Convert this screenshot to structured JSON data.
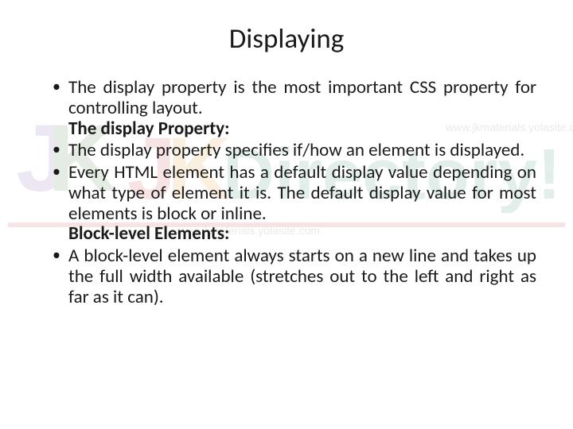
{
  "title": "Displaying",
  "bullets": [
    {
      "text": "The display property is the most important CSS property for controlling layout.",
      "subheading": "The display Property:"
    },
    {
      "text": "The display property specifies if/how an element is displayed.",
      "subheading": null
    },
    {
      "text": "Every HTML element has a default display value depending on what type of element it is. The default display value for most elements is block or inline.",
      "subheading": "Block-level Elements:"
    },
    {
      "text": "A block-level element always starts on a new line and takes up the full width available (stretches out to the left and right as far as it can).",
      "subheading": null
    }
  ],
  "watermark": {
    "brand_left": "JKD",
    "brand_main": "JKDirectory!",
    "url": "www.jkmaterials.yolasite.com"
  }
}
